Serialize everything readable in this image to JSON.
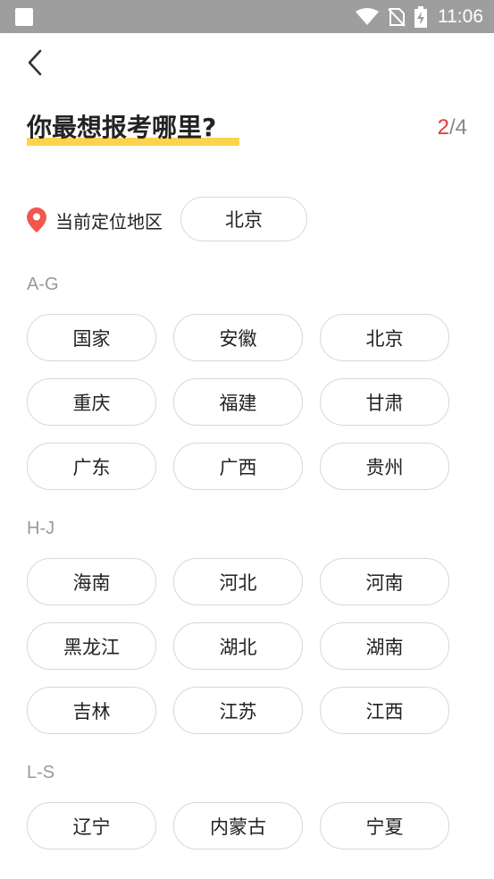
{
  "status_bar": {
    "time": "11:06"
  },
  "header": {
    "title": "你最想报考哪里?",
    "step_current": "2",
    "step_separator": "/",
    "step_total": "4"
  },
  "location": {
    "label": "当前定位地区",
    "value": "北京"
  },
  "sections": [
    {
      "header": "A-G",
      "items": [
        "国家",
        "安徽",
        "北京",
        "重庆",
        "福建",
        "甘肃",
        "广东",
        "广西",
        "贵州"
      ]
    },
    {
      "header": "H-J",
      "items": [
        "海南",
        "河北",
        "河南",
        "黑龙江",
        "湖北",
        "湖南",
        "吉林",
        "江苏",
        "江西"
      ]
    },
    {
      "header": "L-S",
      "items": [
        "辽宁",
        "内蒙古",
        "宁夏"
      ]
    }
  ],
  "colors": {
    "accent_red": "#e53935",
    "highlight_yellow": "#fdd34b",
    "location_pin": "#f0574f",
    "status_bar": "#9e9e9e"
  }
}
